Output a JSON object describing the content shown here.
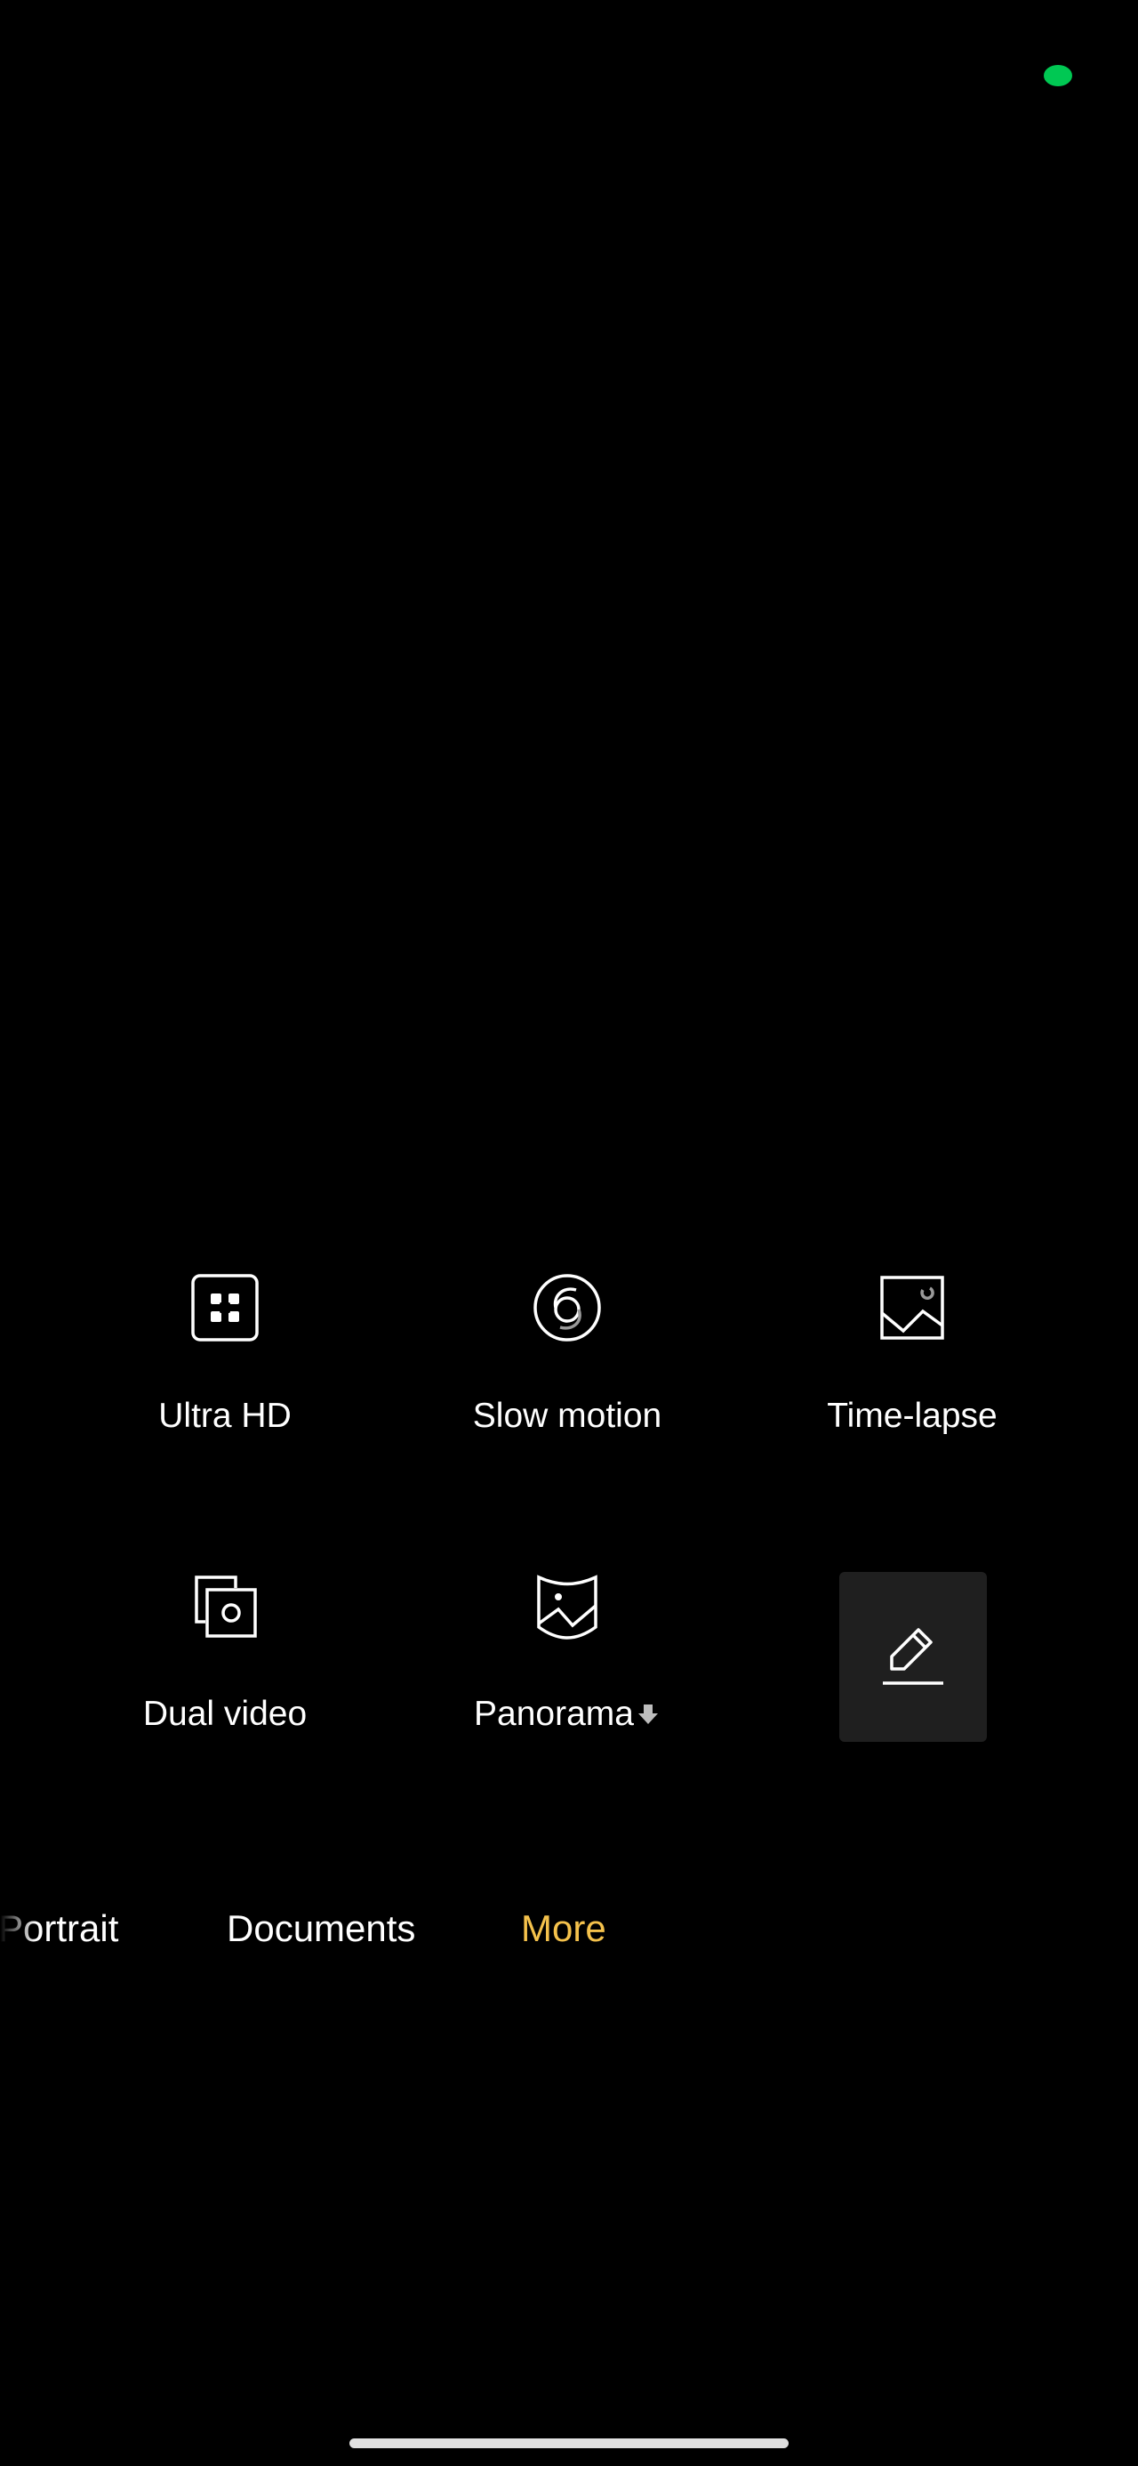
{
  "status": {
    "indicator_color": "#00c853"
  },
  "more_modes": {
    "items": [
      {
        "label": "Ultra HD",
        "icon": "ultra-hd-icon"
      },
      {
        "label": "Slow motion",
        "icon": "slow-motion-icon"
      },
      {
        "label": "Time-lapse",
        "icon": "time-lapse-icon"
      },
      {
        "label": "Dual video",
        "icon": "dual-video-icon"
      },
      {
        "label": "Panorama",
        "icon": "panorama-icon",
        "badge_icon": "download-icon"
      }
    ],
    "edit_icon": "edit-pencil-icon"
  },
  "mode_bar": {
    "items": [
      "Portrait",
      "Documents",
      "More"
    ],
    "active": "More",
    "active_color": "#f5c24c",
    "inactive_color": "#ffffff"
  }
}
